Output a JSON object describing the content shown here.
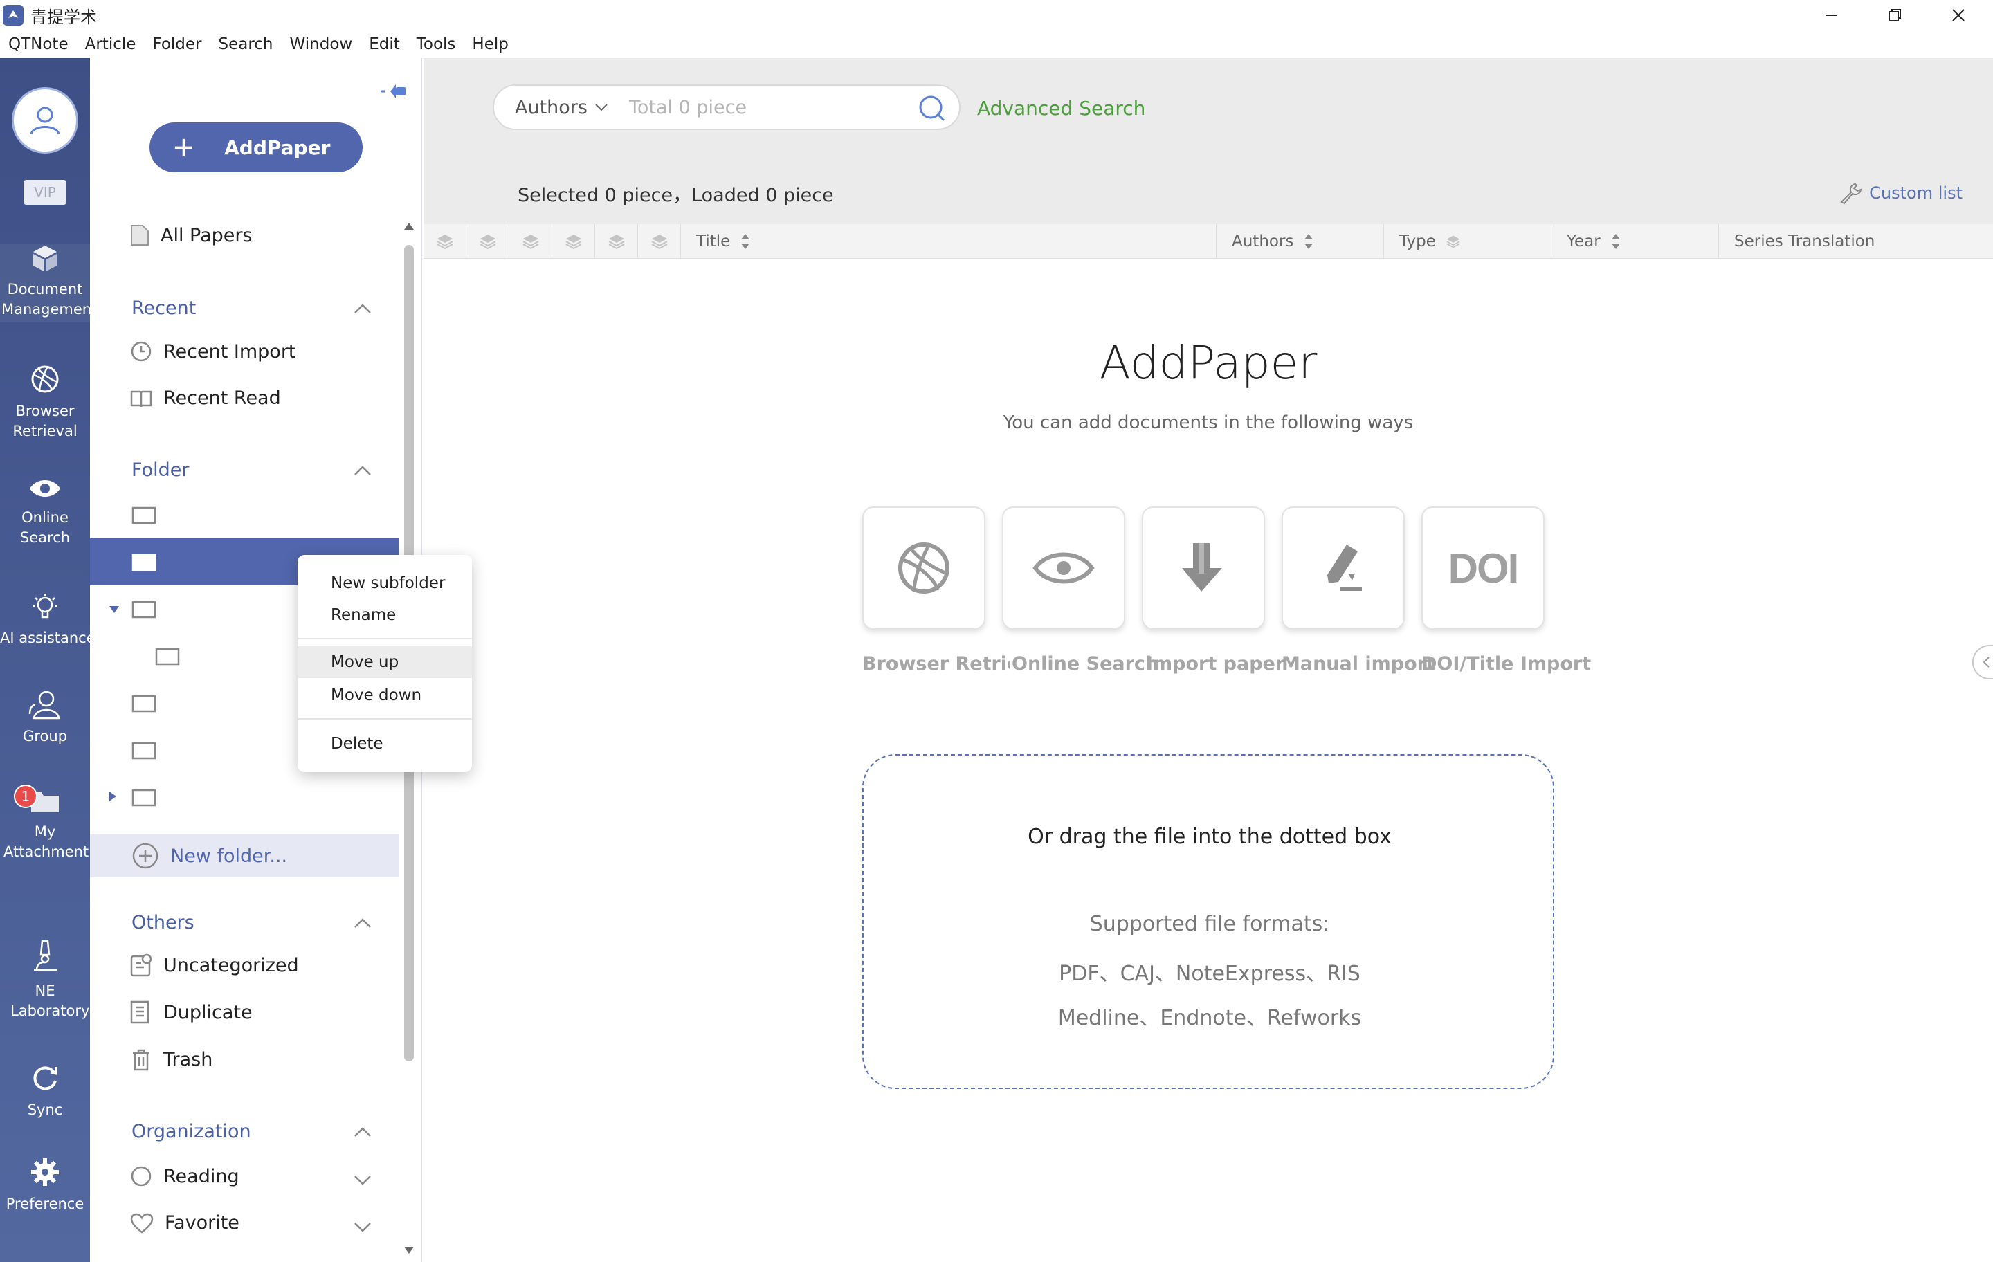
{
  "window": {
    "title": "青提学术"
  },
  "menubar": {
    "items": [
      "QTNote",
      "Article",
      "Folder",
      "Search",
      "Window",
      "Edit",
      "Tools",
      "Help"
    ]
  },
  "rail": {
    "vip_label": "VIP",
    "items": [
      {
        "label": "Document Managemen",
        "icon": "cube-icon"
      },
      {
        "label": "Browser Retrieval",
        "icon": "basketball-icon"
      },
      {
        "label": "Online Search",
        "icon": "eye-icon"
      },
      {
        "label": "AI assistance",
        "icon": "robot-icon"
      },
      {
        "label": "Group",
        "icon": "group-icon"
      },
      {
        "label": "My Attachment",
        "icon": "attachment-icon"
      },
      {
        "label": "NE Laboratory",
        "icon": "microscope-icon"
      },
      {
        "label": "Sync",
        "icon": "sync-icon"
      },
      {
        "label": "Preference",
        "icon": "gear-icon"
      }
    ],
    "attachment_badge": "1"
  },
  "sidebar": {
    "add_paper_label": "AddPaper",
    "all_papers": "All Papers",
    "recent_header": "Recent",
    "recent_import": "Recent Import",
    "recent_read": "Recent Read",
    "folder_header": "Folder",
    "new_folder": "New folder...",
    "others_header": "Others",
    "uncategorized": "Uncategorized",
    "duplicate": "Duplicate",
    "trash": "Trash",
    "organization_header": "Organization",
    "reading": "Reading",
    "favorite": "Favorite"
  },
  "context_menu": {
    "new_subfolder": "New subfolder",
    "rename": "Rename",
    "move_up": "Move up",
    "move_down": "Move down",
    "delete": "Delete"
  },
  "search": {
    "field": "Authors",
    "placeholder": "Total 0 piece",
    "advanced": "Advanced Search"
  },
  "status": {
    "text": "Selected 0 piece，Loaded 0 piece",
    "custom_list": "Custom list"
  },
  "table": {
    "columns": [
      "Title",
      "Authors",
      "Type",
      "Year",
      "Series Translation"
    ]
  },
  "empty_state": {
    "title": "AddPaper",
    "subtitle": "You can add documents in the following ways",
    "ways": [
      {
        "label": "Browser Retrieval",
        "icon": "basketball-icon"
      },
      {
        "label": "Online Search",
        "icon": "eye-icon"
      },
      {
        "label": "Import paper",
        "icon": "download-arrow-icon"
      },
      {
        "label": "Manual import",
        "icon": "pen-icon"
      },
      {
        "label": "DOI/Title Import",
        "icon": "doi-icon",
        "icon_text": "DOI"
      }
    ],
    "drop_title": "Or drag the file into the dotted box",
    "formats_label": "Supported file formats:",
    "formats_line1": "PDF、CAJ、NoteExpress、RIS",
    "formats_line2": "Medline、Endnote、Refworks"
  },
  "colors": {
    "rail": "#46588f",
    "accent": "#5166ad",
    "advanced_search": "#4d9f3e"
  }
}
